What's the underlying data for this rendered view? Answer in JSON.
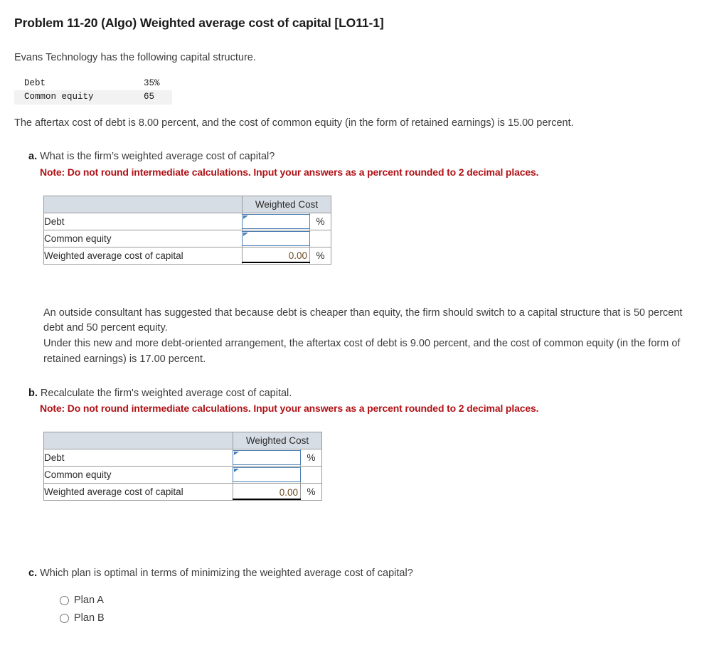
{
  "title": "Problem 11-20 (Algo) Weighted average cost of capital [LO11-1]",
  "intro": "Evans Technology has the following capital structure.",
  "capital_structure": {
    "rows": [
      {
        "label": "Debt",
        "value": "35%"
      },
      {
        "label": "Common equity",
        "value": "65"
      }
    ]
  },
  "aftertax_statement": "The aftertax cost of debt is 8.00 percent, and the cost of common equity (in the form of retained earnings) is 15.00 percent.",
  "question_a": {
    "letter": "a.",
    "text": "What is the firm’s weighted average cost of capital?",
    "note": "Note: Do not round intermediate calculations. Input your answers as a percent rounded to 2 decimal places."
  },
  "table_a": {
    "header_blank": "",
    "header_cost": "Weighted Cost",
    "rows": [
      {
        "label": "Debt",
        "value": "",
        "percent": "%"
      },
      {
        "label": "Common equity",
        "value": "",
        "percent": ""
      },
      {
        "label": "Weighted average cost of capital",
        "value": "0.00",
        "percent": "%"
      }
    ]
  },
  "consultant": {
    "line1": "An outside consultant has suggested that because debt is cheaper than equity, the firm should switch to a capital structure that is 50 percent debt and 50 percent equity.",
    "line2": "Under this new and more debt-oriented arrangement, the aftertax cost of debt is 9.00 percent, and the cost of common equity (in the form of retained earnings) is 17.00 percent."
  },
  "question_b": {
    "letter": "b.",
    "text": "Recalculate the firm's weighted average cost of capital.",
    "note": "Note: Do not round intermediate calculations. Input your answers as a percent rounded to 2 decimal places."
  },
  "table_b": {
    "header_blank": "",
    "header_cost": "Weighted Cost",
    "rows": [
      {
        "label": "Debt",
        "value": "",
        "percent": "%"
      },
      {
        "label": "Common equity",
        "value": "",
        "percent": ""
      },
      {
        "label": "Weighted average cost of capital",
        "value": "0.00",
        "percent": "%"
      }
    ]
  },
  "question_c": {
    "letter": "c.",
    "text": "Which plan is optimal in terms of minimizing the weighted average cost of capital?",
    "options": [
      {
        "label": "Plan A",
        "selected": false
      },
      {
        "label": "Plan B",
        "selected": false
      }
    ]
  },
  "colors": {
    "note_red": "#b01116",
    "header_fill": "#d7dde5",
    "input_border": "#4a7fb5",
    "total_value": "#6b4a1f"
  }
}
